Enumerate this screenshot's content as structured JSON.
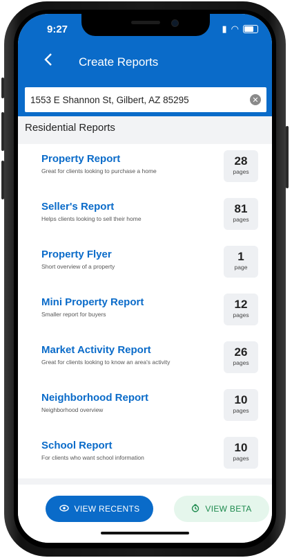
{
  "status": {
    "time": "9:27"
  },
  "header": {
    "title": "Create Reports"
  },
  "search": {
    "value": "1553 E Shannon St, Gilbert, AZ 85295"
  },
  "section": {
    "title": "Residential Reports"
  },
  "reports": [
    {
      "name": "Property Report",
      "desc": "Great for clients looking to purchase a home",
      "pages": "28",
      "unit": "pages"
    },
    {
      "name": "Seller's Report",
      "desc": "Helps clients looking to sell their home",
      "pages": "81",
      "unit": "pages"
    },
    {
      "name": "Property Flyer",
      "desc": "Short overview of a property",
      "pages": "1",
      "unit": "page"
    },
    {
      "name": "Mini Property Report",
      "desc": "Smaller report for buyers",
      "pages": "12",
      "unit": "pages"
    },
    {
      "name": "Market Activity Report",
      "desc": "Great for clients looking to know an area's activity",
      "pages": "26",
      "unit": "pages"
    },
    {
      "name": "Neighborhood Report",
      "desc": "Neighborhood overview",
      "pages": "10",
      "unit": "pages"
    },
    {
      "name": "School Report",
      "desc": "For clients who want school information",
      "pages": "10",
      "unit": "pages"
    }
  ],
  "footer": {
    "recents_label": "VIEW RECENTS",
    "beta_label": "VIEW BETA"
  },
  "colors": {
    "primary": "#0a6bc9",
    "beta_bg": "#e5f6ec",
    "beta_text": "#1e8a4e"
  }
}
